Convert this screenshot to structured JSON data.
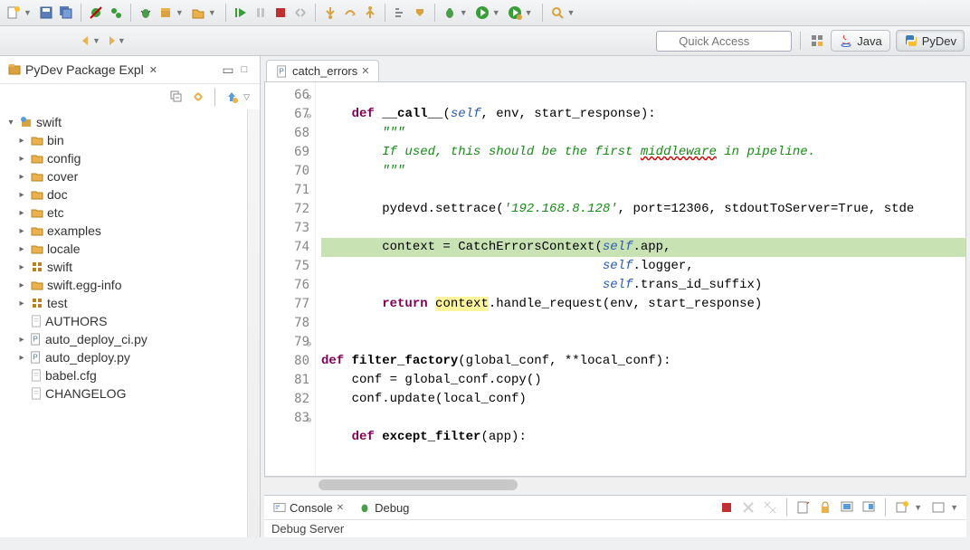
{
  "quick_access": {
    "placeholder": "Quick Access"
  },
  "perspectives": {
    "java": "Java",
    "pydev": "PyDev"
  },
  "package_explorer": {
    "title": "PyDev Package Expl",
    "root": "swift",
    "folders": [
      "bin",
      "config",
      "cover",
      "doc",
      "etc",
      "examples",
      "locale"
    ],
    "packages": [
      "swift",
      "test"
    ],
    "folder_egg": "swift.egg-info",
    "files_py": [
      "auto_deploy_ci.py",
      "auto_deploy.py"
    ],
    "files_plain": [
      "AUTHORS",
      "babel.cfg",
      "CHANGELOG"
    ]
  },
  "editor": {
    "tab_name": "catch_errors",
    "lines": {
      "66": "    def __call__(self, env, start_response):",
      "67": "        \"\"\"",
      "68": "        If used, this should be the first middleware in pipeline.",
      "69": "        \"\"\"",
      "70": "",
      "71": "        pydevd.settrace('192.168.8.128', port=12306, stdoutToServer=True, stde",
      "72": "",
      "73": "        context = CatchErrorsContext(self.app,",
      "74": "                                     self.logger,",
      "75": "                                     self.trans_id_suffix)",
      "76": "        return context.handle_request(env, start_response)",
      "77": "",
      "78": "",
      "79": "def filter_factory(global_conf, **local_conf):",
      "80": "    conf = global_conf.copy()",
      "81": "    conf.update(local_conf)",
      "82": "",
      "83": "    def except_filter(app):"
    }
  },
  "console": {
    "tab_console": "Console",
    "tab_debug": "Debug",
    "body": "Debug Server"
  }
}
